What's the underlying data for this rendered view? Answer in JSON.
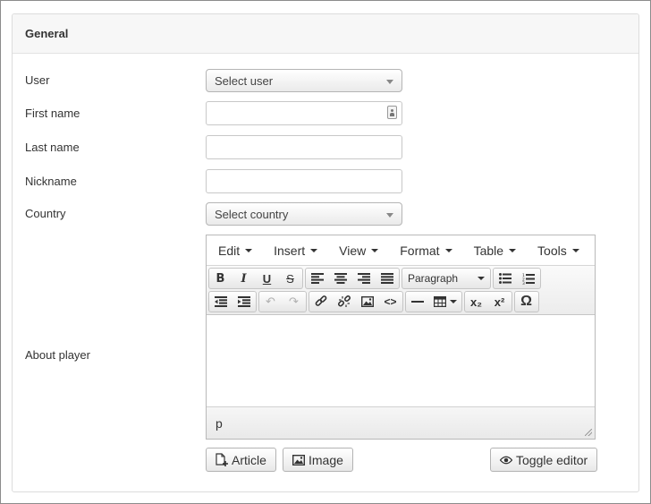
{
  "panel": {
    "heading": "General"
  },
  "form": {
    "user": {
      "label": "User",
      "value": "Select user"
    },
    "first_name": {
      "label": "First name",
      "value": ""
    },
    "last_name": {
      "label": "Last name",
      "value": ""
    },
    "nickname": {
      "label": "Nickname",
      "value": ""
    },
    "country": {
      "label": "Country",
      "value": "Select country"
    },
    "about": {
      "label": "About player"
    }
  },
  "editor": {
    "menus": [
      "Edit",
      "Insert",
      "View",
      "Format",
      "Table",
      "Tools"
    ],
    "block_format": "Paragraph",
    "status_path": "p",
    "icons": {
      "bold": "B",
      "italic": "I",
      "underline": "U",
      "strike": "S",
      "undo": "↶",
      "redo": "↷",
      "code": "<>",
      "hr": "—",
      "subscript": "x₂",
      "superscript": "x²",
      "special_char": "Ω"
    }
  },
  "buttons": {
    "article": "Article",
    "image": "Image",
    "toggle_editor": "Toggle editor"
  }
}
